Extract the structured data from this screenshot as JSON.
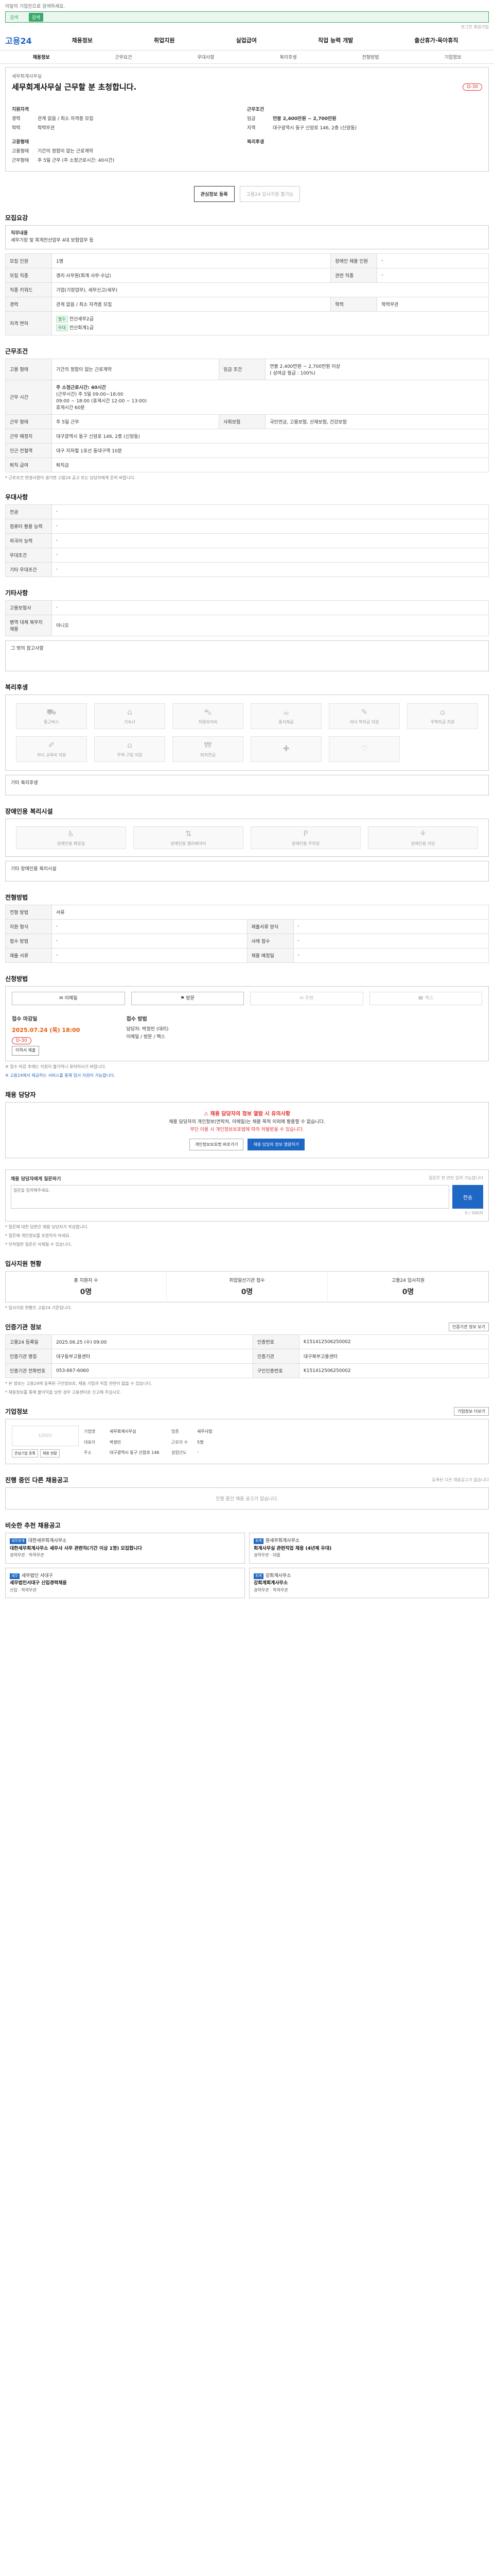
{
  "top_notice": "이달의 기업진으로 검색하세요.",
  "search": {
    "placeholder": "검색",
    "tab": "검색"
  },
  "util_text": "로그인 회원가입",
  "header": {
    "logo": "고용24",
    "menu": [
      "채용정보",
      "취업지원",
      "실업급여",
      "직업 능력 개발",
      "출산휴가·육아휴직"
    ]
  },
  "tabs": [
    "채용정보",
    "근무요건",
    "우대사항",
    "복리후생",
    "전형방법",
    "기업정보"
  ],
  "job": {
    "business_name": "세무회계사무실",
    "title": "세무회계사무실 근무할 분 초청합니다.",
    "dday": "D-30",
    "summary_left_title": "지원자격",
    "experience_label": "경력",
    "experience_value": "관계 없음 / 최소 자격증 모집",
    "edu_label": "학력",
    "edu_value": "학력무관",
    "summary_right_title": "근무조건",
    "wage_label": "임금",
    "wage_value": "연봉 2,400만원 ~ 2,700만원",
    "area_label": "지역",
    "area_value": "대구광역시 동구 신암로 146, 2층 (신암동)",
    "type_title": "고용형태",
    "emp_label": "고용형태",
    "emp_value": "기간의 정함이 없는 근로계약",
    "hours_label": "근무형태",
    "hours_value": "주 5일 근무 (주 소정근로시간: 40시간)",
    "extra_title": "복리후생"
  },
  "buttons": {
    "apply": "관심정보 등록",
    "share": "고용24 입사지원 불가능"
  },
  "sections": {
    "recruit": {
      "title": "모집요강",
      "duty_title": "직무내용",
      "duty": "세무기장 및 회계전산업무 4대 보험업무 등",
      "rows": [
        [
          "모집 인원",
          "1명",
          "장애인 채용 인원",
          "-"
        ],
        [
          "모집 직종",
          "경리·사무원(회계 사무·수납)",
          "관련 직종",
          "-"
        ],
        [
          "직종 키워드",
          "기업(기장업무), 세무신고(세무)",
          "",
          ""
        ],
        [
          "경력",
          "관계 없음 / 최소 자격증 모집",
          "학력",
          "학력무관"
        ]
      ],
      "license_label": "자격 면허",
      "license_tags": [
        "필수",
        "전산세무2급",
        "우대",
        "전산회계1급"
      ]
    },
    "condition": {
      "title": "근무조건",
      "rows": [
        [
          "고용 형태",
          "기간의 정함이 없는 근로계약",
          "임금 조건",
          "연봉 2,400만원 ~ 2,700만원 이상"
        ],
        [
          "근무 시간",
          "(근무시간) 주 5일 09:00~18:00",
          "",
          ""
        ],
        [
          "근무 형태",
          "주 5일 근무",
          "사회보험",
          "국민연금, 고용보험, 산재보험, 건강보험"
        ],
        [
          "근무 예정지",
          "대구광역시 동구 신암로 146, 2층 (신암동)",
          "",
          ""
        ],
        [
          "인근 전철역",
          "대구 지하철 1호선 동대구역 10분",
          "",
          ""
        ],
        [
          "퇴직 급여",
          "퇴직금",
          "",
          ""
        ]
      ],
      "wage_sub": "( 상여금 월급 : 100%)",
      "week_label": "주 소정근로시간: 40시간",
      "break_label": "휴게시간 60분",
      "work_note": "09:00 ~ 18:00 (휴게시간 12:00 ~ 13:00)",
      "note": "* 근로조건 변경사항이 생기면 고용24 공고 또는 담당자에게 문의 바랍니다."
    },
    "pref": {
      "title": "우대사항",
      "rows": [
        [
          "전공",
          "-"
        ],
        [
          "컴퓨터 활용 능력",
          "-"
        ],
        [
          "외국어 능력",
          "-"
        ],
        [
          "우대조건",
          "-"
        ],
        [
          "기타 우대조건",
          "-"
        ]
      ]
    },
    "other": {
      "title": "기타사항",
      "rows": [
        [
          "고용보험사",
          "-"
        ],
        [
          "병역 대체 복무지 채용",
          "아니오"
        ]
      ],
      "notice": "그 밖의 참고사항"
    },
    "welfare": {
      "title": "복리후생",
      "items": [
        "통근버스",
        "기숙사",
        "차량유지비",
        "중식제공",
        "자녀 학자금 지원",
        "주택자금 지원",
        "자녀 교육비 지원",
        "주택 구입 지원",
        "퇴직연금",
        "",
        ""
      ],
      "etc": "기타 복리후생"
    },
    "disabled": {
      "title": "장애인용 복리시설",
      "items": [
        "장애인용 화장실",
        "장애인용 엘리베이터",
        "장애인용 주차장",
        "장애인용 식당"
      ],
      "etc": "기타 장애인용 복리시설"
    },
    "selection": {
      "title": "전형방법",
      "rows": [
        [
          "전형 방법",
          "서류",
          "",
          ""
        ],
        [
          "지원 형식",
          "-",
          "제출서류 양식",
          "-"
        ],
        [
          "접수 방법",
          "-",
          "사례 접수",
          "-"
        ],
        [
          "제출 서류",
          "-",
          "채용 예정일",
          "-"
        ]
      ]
    },
    "apply_method": {
      "title": "신청방법",
      "items": [
        "이메일",
        "방문",
        "우편",
        "팩스"
      ]
    },
    "period": {
      "label": "접수 마감일",
      "date": "2025.07.24 (목) 18:00",
      "dday": "D-30",
      "btn": "이력서 제출",
      "label2": "접수 방법",
      "contact": "담당자: 박정민 (대리)",
      "contact2": "이메일 / 방문 / 팩스",
      "note1": "※ 접수 마감 후에는 지원이 불가하니 유의하시기 바랍니다.",
      "note2": "※ 고용24에서 제공하는 서비스를 통해 입사 지원이 가능합니다."
    },
    "manager": {
      "title": "채용 담당자",
      "warn": "채용 담당자의 정보 열람 시 유의사항",
      "text": "채용 담당자의 개인정보(연락처, 이메일)는 채용 목적 이외에 활용할 수 없습니다.",
      "red": "무단 이용 시 개인정보보호법에 따라 처벌받을 수 있습니다.",
      "btn1": "개인정보보호법 바로가기",
      "btn2": "채용 담당자 정보 열람하기"
    },
    "qa": {
      "title": "채용 담당자에게 질문하기",
      "hint": "질문은 한 번만 입력 가능합니다",
      "placeholder": "질문을 입력해주세요.",
      "send": "전송",
      "count": "0 / 500자",
      "notes": [
        "* 질문에 대한 답변은 채용 담당자가 작성합니다.",
        "* 질문에 개인정보를 포함하지 마세요.",
        "* 부적절한 질문은 삭제될 수 있습니다."
      ]
    },
    "status": {
      "title": "입사지원 현황",
      "items": [
        [
          "총 지원자 수",
          "0명"
        ],
        [
          "취업알선기관 접수",
          "0명"
        ],
        [
          "고용24 입사지원",
          "0명"
        ]
      ],
      "note": "* 입사지원 현황은 고용24 기준입니다."
    },
    "recruit_info": {
      "title": "인증기관 정보",
      "btn": "인증기관 정보 보기",
      "rows": [
        [
          "고용24 등록일",
          "2025.06.25 (수) 09:00",
          "인증번호",
          "K151412506250002"
        ],
        [
          "인증기관 명칭",
          "대구동부고용센터",
          "인증기관",
          "대구북부고용센터"
        ],
        [
          "인증기관 전화번호",
          "053-667-6060",
          "구인인증번호",
          "K151412506250002"
        ]
      ],
      "notes": [
        "* 본 정보는 고용24에 등록된 구인정보로, 채용 기업과 직접 관련이 없을 수 있습니다.",
        "* 채용정보를 통해 불이익을 당한 경우 고용센터로 신고해 주십시오."
      ]
    },
    "company": {
      "title": "기업정보",
      "btn": "기업정보 더보기",
      "logo": "LOGO",
      "btn1": "관심기업 등록",
      "btn2": "채용 현황",
      "kv": [
        [
          "기업명",
          "세무회계사무실"
        ],
        [
          "업종",
          "세무사업"
        ],
        [
          "대표자",
          "박정민"
        ],
        [
          "근로자 수",
          "5명"
        ],
        [
          "주소",
          "대구광역시 동구 신암로 146"
        ],
        [
          "설립년도",
          "-"
        ]
      ]
    },
    "same_company": {
      "title": "진행 중인 다른 채용공고",
      "hint": "등록된 다른 채용공고가 없습니다",
      "empty": "진행 중인 채용 공고가 없습니다."
    },
    "similar": {
      "title": "비슷한 추천 채용공고",
      "cards": [
        {
          "label": "세무회계",
          "company": "대한세무회계사무소",
          "title": "대한세무회계사무소 세무사 사무 관련직(기간 이상 1명) 모집합니다",
          "meta1": "경력무관",
          "meta2": "학력무관"
        },
        {
          "label": "회계",
          "company": "원세무회계사무소",
          "title": "회계사무실 관련직업 채용 (4년제 우대)",
          "meta1": "경력무관",
          "meta2": "대졸"
        },
        {
          "label": "세무",
          "company": "세무법인 서대구",
          "title": "세무법인서대구 신입경력채용",
          "meta1": "신입",
          "meta2": "학력무관"
        },
        {
          "label": "회계",
          "company": "강회계사무소",
          "title": "강회계회계사무소",
          "meta1": "경력무관",
          "meta2": "학력무관"
        }
      ]
    }
  }
}
